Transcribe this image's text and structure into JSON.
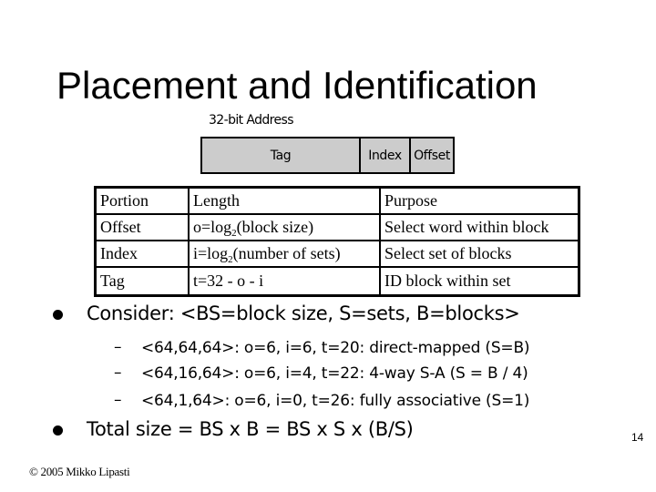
{
  "slide": {
    "title": "Placement and Identification",
    "page_number": "14",
    "footer": "© 2005 Mikko Lipasti"
  },
  "address_diagram": {
    "label": "32-bit Address",
    "fields": [
      "Tag",
      "Index",
      "Offset"
    ],
    "fill_color": "#cccccc"
  },
  "table": {
    "header": [
      "Portion",
      "Length",
      "Purpose"
    ],
    "rows": [
      {
        "portion": "Offset",
        "length_prefix": "o=log",
        "length_sub": "2",
        "length_suffix": "(block size)",
        "purpose": "Select word within block"
      },
      {
        "portion": "Index",
        "length_prefix": "i=log",
        "length_sub": "2",
        "length_suffix": "(number of sets)",
        "purpose": "Select set of blocks"
      },
      {
        "portion": "Tag",
        "length_prefix": "t=32 - o - i",
        "length_sub": "",
        "length_suffix": "",
        "purpose": "ID block within set"
      }
    ]
  },
  "bullets": [
    {
      "text": "Consider: <BS=block size, S=sets, B=blocks>",
      "subitems": [
        "<64,64,64>: o=6, i=6, t=20: direct-mapped (S=B)",
        "<64,16,64>: o=6, i=4, t=22: 4-way S-A (S = B / 4)",
        "<64,1,64>: o=6, i=0, t=26: fully associative (S=1)"
      ]
    },
    {
      "text": "Total size = BS x B = BS x S x (B/S)",
      "subitems": []
    }
  ]
}
